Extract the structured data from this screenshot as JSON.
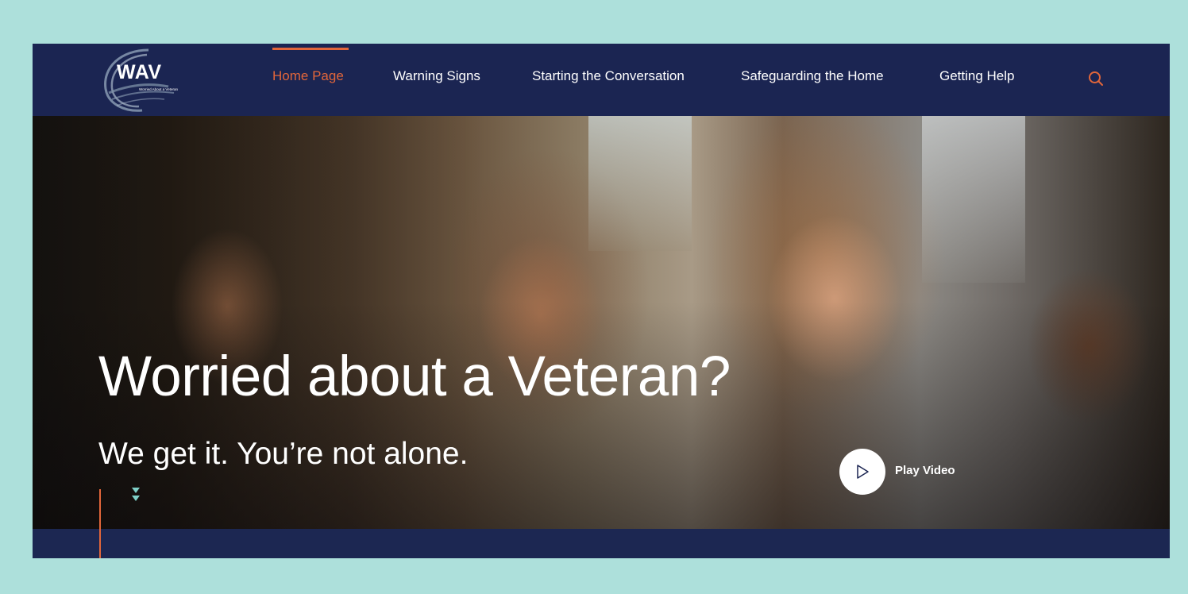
{
  "logo": {
    "text": "WAV",
    "subtitle": "Worried About a Veteran",
    "icon": "wave-swoosh-logo"
  },
  "nav": {
    "items": [
      {
        "label": "Home Page",
        "active": true
      },
      {
        "label": "Warning Signs",
        "active": false
      },
      {
        "label": "Starting the Conversation",
        "active": false
      },
      {
        "label": "Safeguarding the Home",
        "active": false
      },
      {
        "label": "Getting Help",
        "active": false
      }
    ],
    "search_icon": "search-icon"
  },
  "hero": {
    "title": "Worried about a Veteran?",
    "subtitle": "We get it. You’re not alone.",
    "play_label": "Play Video",
    "play_icon": "play-icon",
    "scroll_icon": "double-chevron-down-icon"
  },
  "colors": {
    "page_bg": "#ade0db",
    "header_bg": "#1b2552",
    "accent": "#e2663a",
    "scroll_arrow": "#7fd0c8",
    "text": "#ffffff"
  }
}
